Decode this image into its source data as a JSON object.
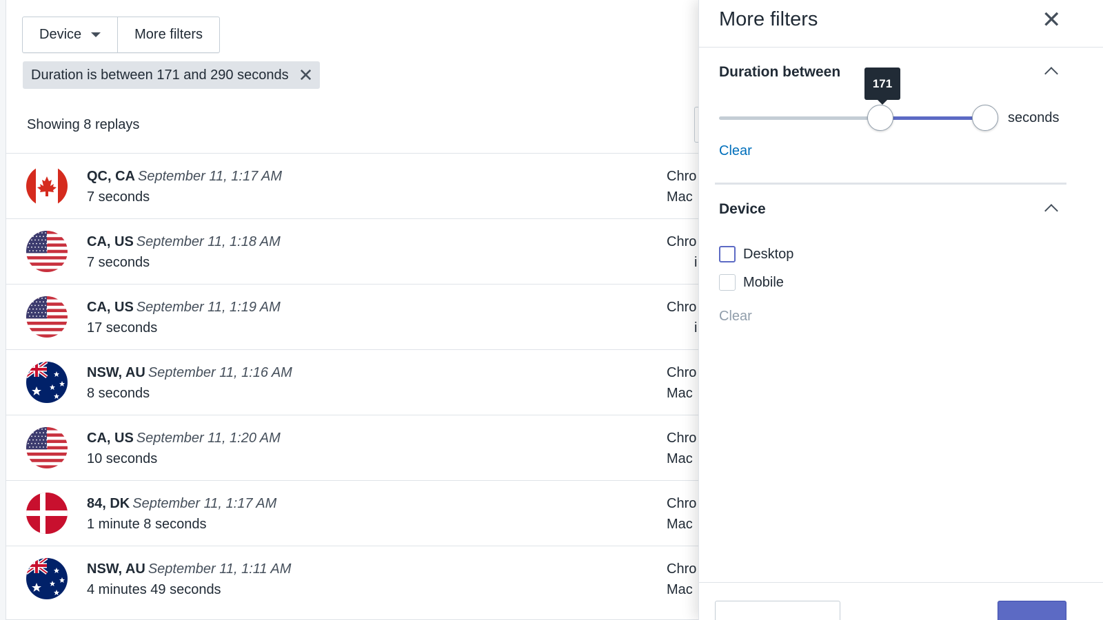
{
  "toolbar": {
    "device_label": "Device",
    "more_filters_label": "More filters"
  },
  "active_filter": {
    "label": "Duration is between 171 and 290 seconds",
    "remove_glyph": "✕"
  },
  "summary": "Showing 8 replays",
  "replays": [
    {
      "flag": "canada-flag-icon",
      "location": "QC, CA",
      "date": "September 11, 1:17 AM",
      "duration": "7 seconds",
      "browser": "Chro",
      "os": "Mac"
    },
    {
      "flag": "us-flag-icon",
      "location": "CA, US",
      "date": "September 11, 1:18 AM",
      "duration": "7 seconds",
      "browser": "Chro",
      "os": "i"
    },
    {
      "flag": "us-flag-icon",
      "location": "CA, US",
      "date": "September 11, 1:19 AM",
      "duration": "17 seconds",
      "browser": "Chro",
      "os": "i"
    },
    {
      "flag": "australia-flag-icon",
      "location": "NSW, AU",
      "date": "September 11, 1:16 AM",
      "duration": "8 seconds",
      "browser": "Chro",
      "os": "Mac"
    },
    {
      "flag": "us-flag-icon",
      "location": "CA, US",
      "date": "September 11, 1:20 AM",
      "duration": "10 seconds",
      "browser": "Chro",
      "os": "Mac"
    },
    {
      "flag": "denmark-flag-icon",
      "location": "84, DK",
      "date": "September 11, 1:17 AM",
      "duration": "1 minute 8 seconds",
      "browser": "Chro",
      "os": "Mac"
    },
    {
      "flag": "australia-flag-icon",
      "location": "NSW, AU",
      "date": "September 11, 1:11 AM",
      "duration": "4 minutes 49 seconds",
      "browser": "Chro",
      "os": "Mac"
    }
  ],
  "panel": {
    "title": "More filters",
    "close_glyph": "✕",
    "duration": {
      "title": "Duration between",
      "tooltip_value": "171",
      "range_low_fraction": 0.6,
      "range_high_fraction": 0.99,
      "unit": "seconds",
      "clear_label": "Clear"
    },
    "device": {
      "title": "Device",
      "options": [
        {
          "label": "Desktop",
          "checked": false
        },
        {
          "label": "Mobile",
          "checked": false
        }
      ],
      "clear_label": "Clear"
    }
  },
  "colors": {
    "accent": "#5c6ac4",
    "link": "#006fbb",
    "text": "#212b36"
  }
}
